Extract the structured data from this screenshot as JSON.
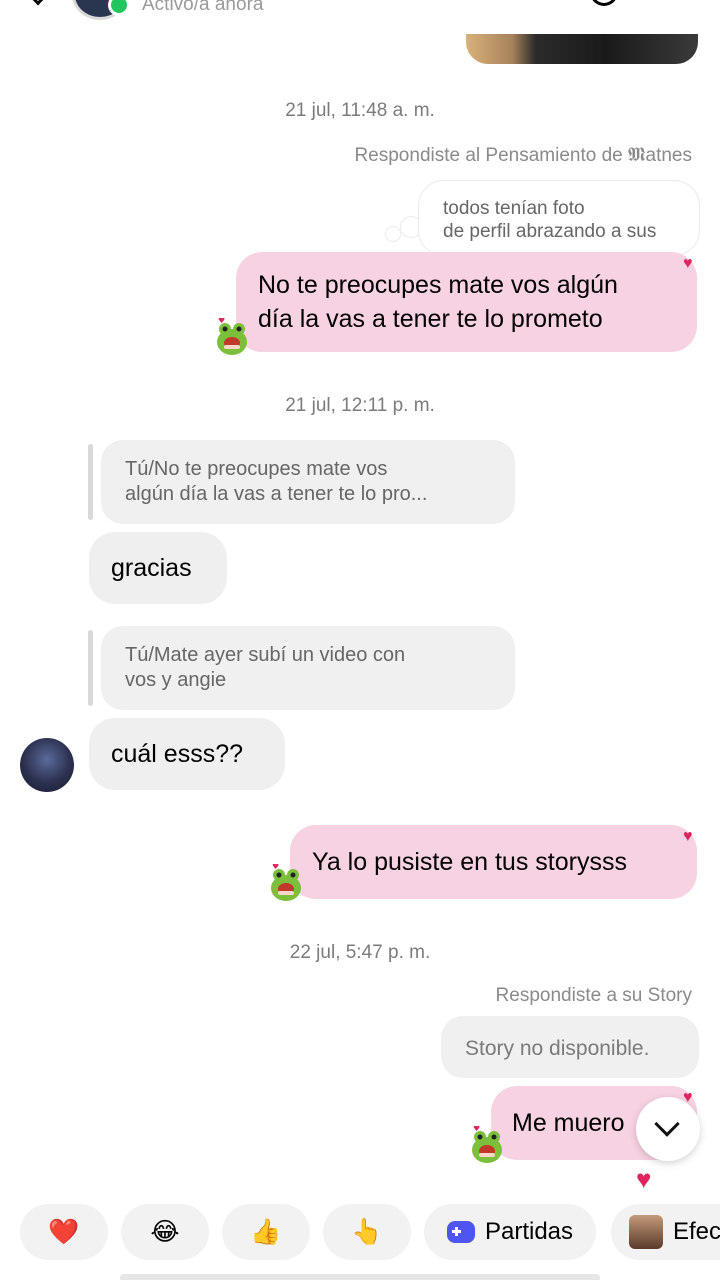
{
  "header": {
    "status": "Activo/a ahora"
  },
  "timestamps": [
    "21 jul, 11:48 a. m.",
    "21 jul, 12:11 p. m.",
    "22 jul, 5:47 p. m."
  ],
  "thought_reply": {
    "caption": "Respondiste al Pensamiento de 𝕸atnes",
    "thought_line1": "todos tenían foto",
    "thought_line2": "de perfil abrazando a sus"
  },
  "messages": {
    "out1_line1": "No te preocupes mate vos algún",
    "out1_line2": "día la vas a tener te lo prometo",
    "quote1_line1": "Tú/No te preocupes mate vos",
    "quote1_line2": "algún día la vas a tener te lo pro...",
    "in1": "gracias",
    "quote2_line1": "Tú/Mate ayer subí un video con",
    "quote2_line2": "vos y angie",
    "in2": "cuál esss??",
    "out2": "Ya lo pusiste en tus storysss",
    "story_caption": "Respondiste a su Story",
    "story_unavailable": "Story no disponible.",
    "out3": "Me muero"
  },
  "quick_bar": {
    "heart": "❤️",
    "laugh": "😂",
    "thumbs": "👍",
    "point": "👆",
    "games_label": "Partidas",
    "effects_label": "Efec"
  },
  "colors": {
    "outgoing_bubble": "#f7d2e3",
    "incoming_bubble": "#efefef",
    "online": "#22c55e",
    "accent_heart": "#e0245e"
  },
  "icons": [
    "back-arrow-icon",
    "scroll-down-icon",
    "gamepad-icon",
    "frog-sticker-icon"
  ]
}
